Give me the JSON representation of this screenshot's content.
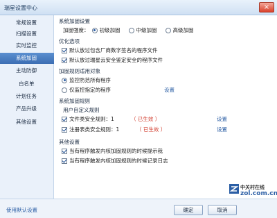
{
  "window": {
    "title": "瑞星设置中心",
    "close_glyph": "×"
  },
  "sidebar": {
    "items": [
      {
        "label": "常规设置"
      },
      {
        "label": "扫描设置"
      },
      {
        "label": "实时监控"
      },
      {
        "label": "系统加固"
      },
      {
        "label": "主动防御"
      },
      {
        "label": "白名单"
      },
      {
        "label": "计划任务"
      },
      {
        "label": "产品升级"
      },
      {
        "label": "其他设置"
      }
    ],
    "active": "系统加固"
  },
  "main": {
    "section_title": "系统加固设置",
    "strength": {
      "label": "加固强度：",
      "options": [
        {
          "label": "初级加固",
          "selected": true
        },
        {
          "label": "中级加固",
          "selected": false
        },
        {
          "label": "高级加固",
          "selected": false
        }
      ]
    },
    "optimize": {
      "title": "优化选项",
      "items": [
        {
          "label": "默认放过包含厂商数字签名的程序文件",
          "checked": true
        },
        {
          "label": "默认放过瑞星云安全鉴定安全的程序文件",
          "checked": true
        }
      ]
    },
    "scope": {
      "title": "加固规则适用对象",
      "options": [
        {
          "label": "监控防范所有程序",
          "selected": true
        },
        {
          "label": "仅监控指定的程序",
          "selected": false
        }
      ],
      "settings_link": "设置"
    },
    "rules": {
      "title": "系统加固规则",
      "subtitle": "用户自定义规则",
      "items": [
        {
          "label": "文件类安全规则：1",
          "status": "（ 已生效 ）",
          "link": "设置",
          "checked": true
        },
        {
          "label": "注册表类安全规则：1",
          "status": "（ 已生效 ）",
          "link": "设置",
          "checked": true
        }
      ]
    },
    "other": {
      "title": "其他设置",
      "items": [
        {
          "label": "当有程序触发内核加固规则的时候提示我",
          "checked": true
        },
        {
          "label": "当有程序触发内核加固规则的时候记录日志",
          "checked": true
        }
      ]
    }
  },
  "footer": {
    "default_link": "使用默认设置",
    "ok": "确定",
    "cancel": "取消"
  },
  "watermark": {
    "cn": "中关村在线",
    "url": "zol.com.cn"
  },
  "colors": {
    "accent": "#3c6eb3",
    "link": "#2b5ea5",
    "status": "#d13a2b"
  }
}
